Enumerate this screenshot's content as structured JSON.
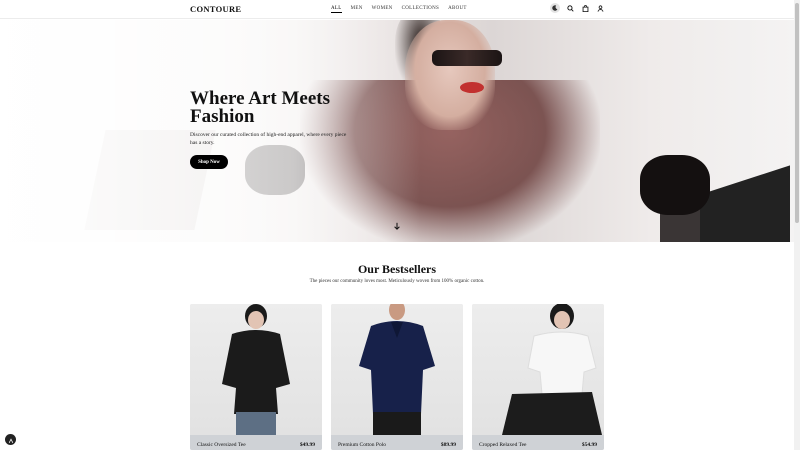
{
  "brand": {
    "logo": "CONTOURE"
  },
  "nav": {
    "items": [
      {
        "label": "ALL",
        "active": true
      },
      {
        "label": "MEN",
        "active": false
      },
      {
        "label": "WOMEN",
        "active": false
      },
      {
        "label": "COLLECTIONS",
        "active": false
      },
      {
        "label": "ABOUT",
        "active": false
      }
    ]
  },
  "header_icons": [
    "theme-toggle-icon",
    "search-icon",
    "shopping-bag-icon",
    "user-icon"
  ],
  "hero": {
    "title": "Where Art Meets Fashion",
    "description": "Discover our curated collection of high-end apparel, where every piece has a story.",
    "cta_label": "Shop Now"
  },
  "bestsellers": {
    "title": "Our Bestsellers",
    "subtitle": "The pieces our community loves most. Meticulously woven from 100% organic cotton.",
    "products": [
      {
        "name": "Classic Oversized Tee",
        "price": "$49.99"
      },
      {
        "name": "Premium Cotton Polo",
        "price": "$89.99"
      },
      {
        "name": "Cropped Relaxed Tee",
        "price": "$54.99"
      }
    ]
  },
  "colors": {
    "accent": "#000000",
    "card_footer": "#cfd2d6"
  }
}
